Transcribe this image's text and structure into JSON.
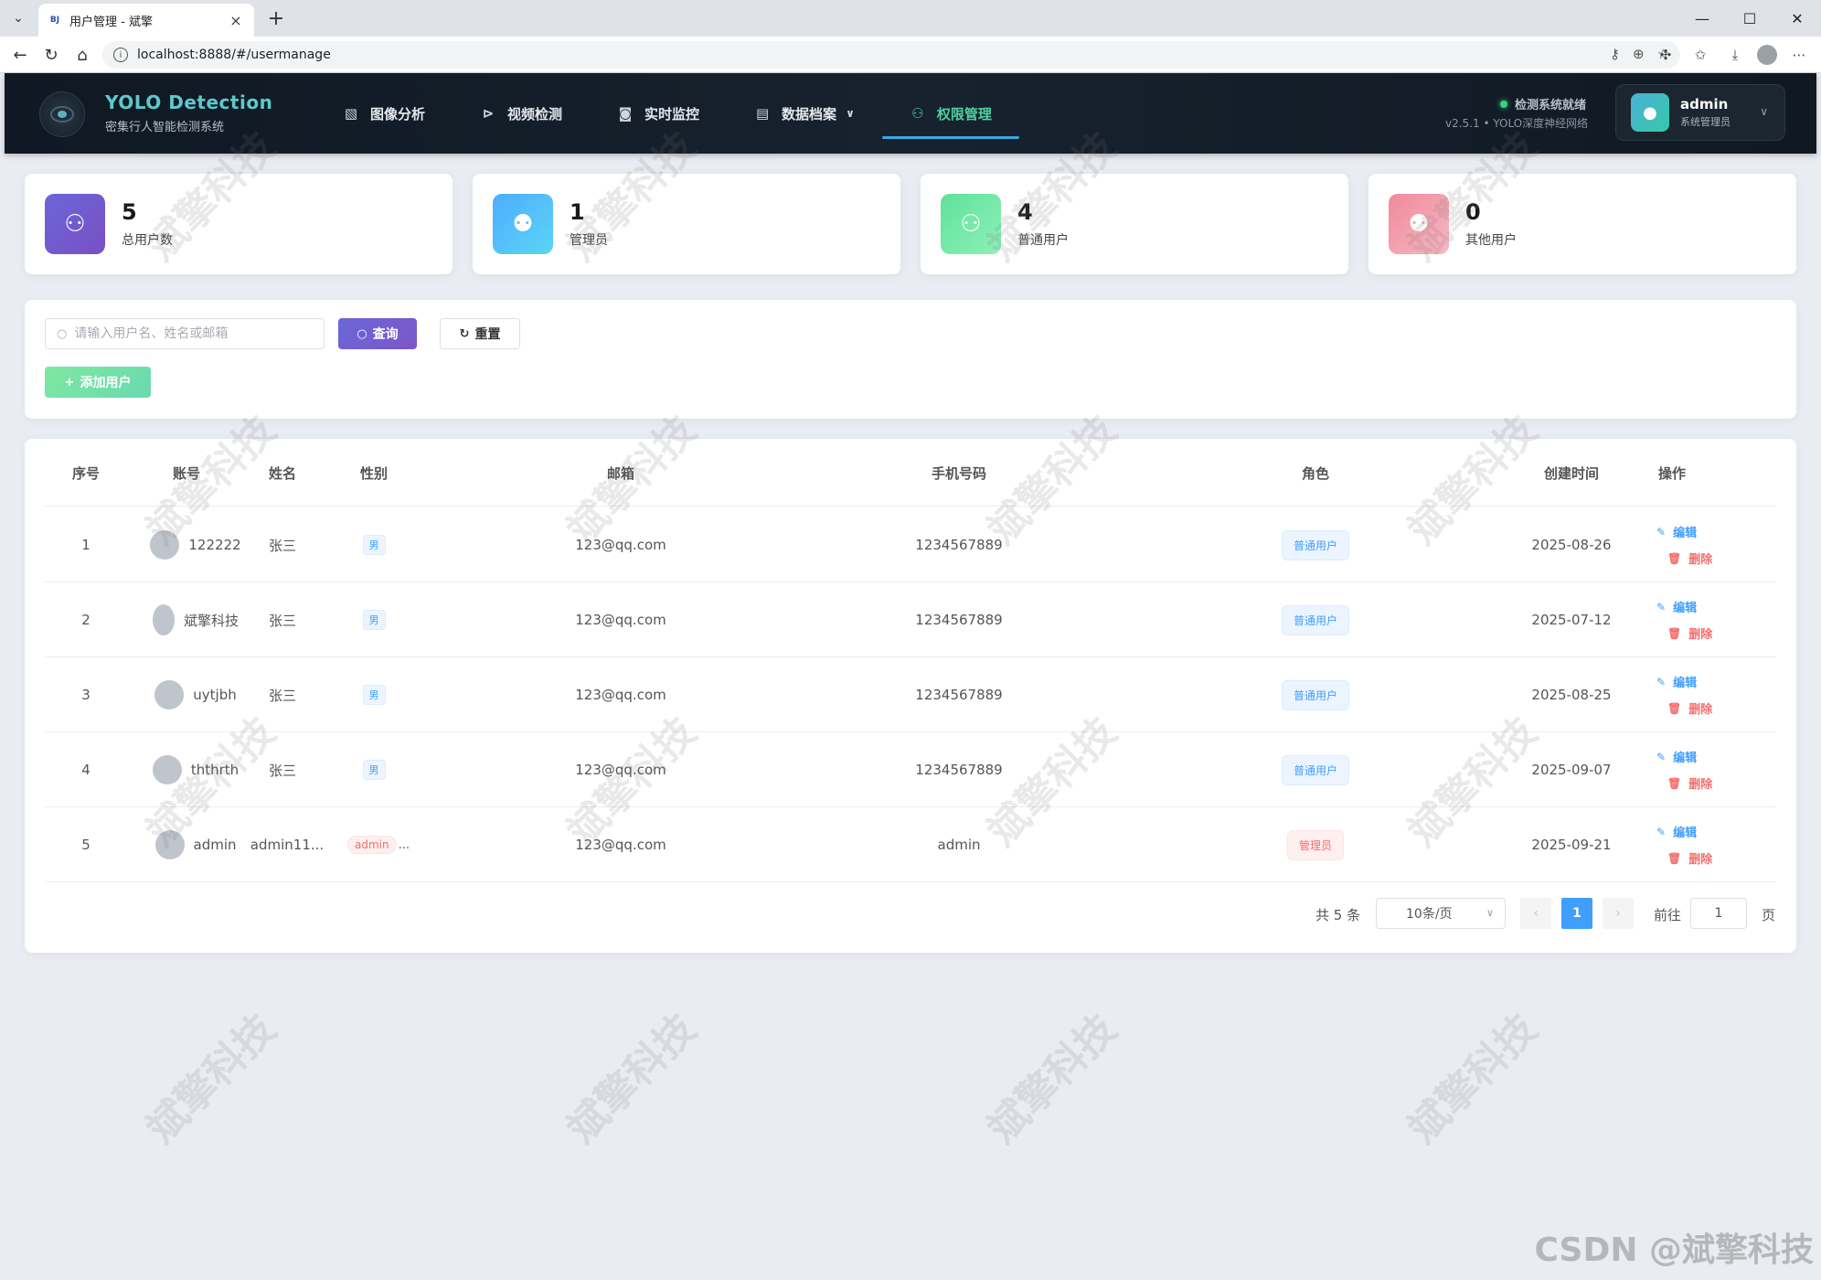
{
  "browser": {
    "tab_title": "用户管理 - 斌擎",
    "favicon_text": "BJ",
    "url": "localhost:8888/#/usermanage"
  },
  "header": {
    "brand_title": "YOLO Detection",
    "brand_subtitle": "密集行人智能检测系统",
    "nav": [
      {
        "label": "图像分析",
        "icon": "image-icon"
      },
      {
        "label": "视频检测",
        "icon": "play-circle-icon"
      },
      {
        "label": "实时监控",
        "icon": "camera-icon"
      },
      {
        "label": "数据档案",
        "icon": "document-icon"
      },
      {
        "label": "权限管理",
        "icon": "user-icon"
      }
    ],
    "active_nav": "权限管理",
    "status": "检测系统就绪",
    "version": "v2.5.1 • YOLO深度神经网络",
    "user_name": "admin",
    "user_role": "系统管理员"
  },
  "stats": [
    {
      "value": "5",
      "label": "总用户数",
      "color": "#6a5acd"
    },
    {
      "value": "1",
      "label": "管理员",
      "color": "#4facfe"
    },
    {
      "value": "4",
      "label": "普通用户",
      "color": "#43e97b"
    },
    {
      "value": "0",
      "label": "其他用户",
      "color": "#f093a0"
    }
  ],
  "search": {
    "placeholder": "请输入用户名、姓名或邮箱",
    "query_label": "查询",
    "reset_label": "重置",
    "add_label": "添加用户"
  },
  "table": {
    "columns": [
      "序号",
      "账号",
      "姓名",
      "性别",
      "邮箱",
      "手机号码",
      "角色",
      "创建时间",
      "操作"
    ],
    "rows": [
      {
        "index": "1",
        "account": "122222",
        "name": "张三",
        "gender": "男",
        "email": "123@qq.com",
        "phone": "1234567889",
        "role": "普通用户",
        "created": "2025-08-26"
      },
      {
        "index": "2",
        "account": "斌擎科技",
        "name": "张三",
        "gender": "男",
        "email": "123@qq.com",
        "phone": "1234567889",
        "role": "普通用户",
        "created": "2025-07-12"
      },
      {
        "index": "3",
        "account": "uytjbh",
        "name": "张三",
        "gender": "男",
        "email": "123@qq.com",
        "phone": "1234567889",
        "role": "普通用户",
        "created": "2025-08-25"
      },
      {
        "index": "4",
        "account": "ththrth",
        "name": "张三",
        "gender": "男",
        "email": "123@qq.com",
        "phone": "1234567889",
        "role": "普通用户",
        "created": "2025-09-07"
      },
      {
        "index": "5",
        "account": "admin",
        "name": "admin11...",
        "gender": "admin",
        "gender_suffix": "...",
        "email": "123@qq.com",
        "phone": "admin",
        "role": "管理员",
        "created": "2025-09-21"
      }
    ],
    "edit_label": "编辑",
    "delete_label": "删除"
  },
  "pagination": {
    "total": "共 5 条",
    "page_size": "10条/页",
    "current_page": "1",
    "goto_label": "前往",
    "goto_value": "1",
    "page_suffix": "页"
  },
  "watermark": "斌擎科技",
  "footer_mark": "CSDN @斌擎科技"
}
